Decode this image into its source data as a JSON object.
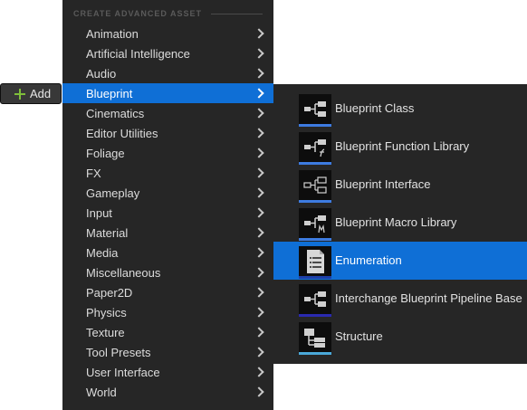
{
  "add_button": {
    "label": "Add",
    "icon": "plus-icon"
  },
  "main_menu": {
    "header": "CREATE ADVANCED ASSET",
    "items": [
      {
        "label": "Animation"
      },
      {
        "label": "Artificial Intelligence"
      },
      {
        "label": "Audio"
      },
      {
        "label": "Blueprint",
        "active": true
      },
      {
        "label": "Cinematics"
      },
      {
        "label": "Editor Utilities"
      },
      {
        "label": "Foliage"
      },
      {
        "label": "FX"
      },
      {
        "label": "Gameplay"
      },
      {
        "label": "Input"
      },
      {
        "label": "Material"
      },
      {
        "label": "Media"
      },
      {
        "label": "Miscellaneous"
      },
      {
        "label": "Paper2D"
      },
      {
        "label": "Physics"
      },
      {
        "label": "Texture"
      },
      {
        "label": "Tool Presets"
      },
      {
        "label": "User Interface"
      },
      {
        "label": "World"
      }
    ]
  },
  "sub_menu": {
    "items": [
      {
        "label": "Blueprint Class",
        "icon": "blueprint-class-icon",
        "accent": "#3d7be0"
      },
      {
        "label": "Blueprint Function Library",
        "icon": "blueprint-function-library-icon",
        "accent": "#3d7be0"
      },
      {
        "label": "Blueprint Interface",
        "icon": "blueprint-interface-icon",
        "accent": "#3d7be0"
      },
      {
        "label": "Blueprint Macro Library",
        "icon": "blueprint-macro-library-icon",
        "accent": "#3d7be0"
      },
      {
        "label": "Enumeration",
        "icon": "enumeration-icon",
        "accent": "#1e3fa8",
        "active": true
      },
      {
        "label": "Interchange Blueprint Pipeline Base",
        "icon": "interchange-pipeline-icon",
        "accent": "#2a2ab0"
      },
      {
        "label": "Structure",
        "icon": "structure-icon",
        "accent": "#4aa8d8"
      }
    ]
  },
  "colors": {
    "menu_bg": "#262626",
    "highlight": "#0f6fd6",
    "text": "#dcdcdc",
    "header_text": "#5a5a5a",
    "add_plus": "#7fbf3a"
  }
}
